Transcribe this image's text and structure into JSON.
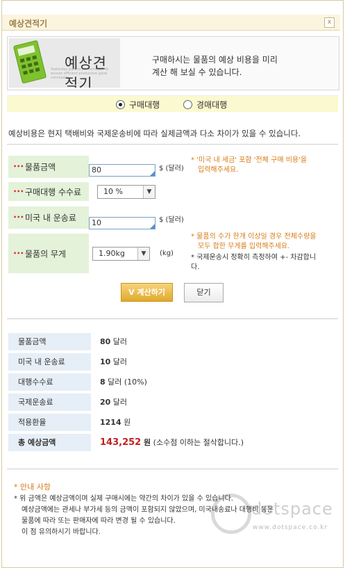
{
  "window": {
    "title": "예상견적기",
    "close_icon": "close-icon"
  },
  "hero": {
    "title": "예상견적기",
    "desc_line1": "구매하시는 물품의 예상 비용을 미리",
    "desc_line2": "계산 해 보실 수 있습니다.",
    "blur_text": "Yesterday plan to perform SEO to ensure efficient productive good conclusion"
  },
  "mode": {
    "option1": "구매대행",
    "option2": "경매대행",
    "selected": "구매대행"
  },
  "notice": "예상비용은 현지 택배비와 국제운송비에 따라 실제금액과 다소 차이가 있을 수 있습니다.",
  "form": {
    "price_label": "물품금액",
    "price_value": "80",
    "price_unit": "$ (달러)",
    "price_note_line1": "* '미국 내 세금' 포함 '전체 구매 비용'을",
    "price_note_line2": "입력해주세요.",
    "fee_label": "구매대행 수수료",
    "fee_value": "10 %",
    "shipping_label": "미국 내 운송료",
    "shipping_value": "10",
    "shipping_unit": "$ (달러)",
    "weight_label": "물품의 무게",
    "weight_value": "1.90kg",
    "weight_unit": "(kg)",
    "weight_note_line1": "* 물품의 수가 한개 이상일 경우 전체수량을",
    "weight_note_line2": "모두 합한 무게를 입력해주세요.",
    "weight_note2_line1": "* 국제운송시 정확히 측정하여 +- 차감합니",
    "weight_note2_line2": "다."
  },
  "buttons": {
    "calc": "V 계산하기",
    "close": "닫기"
  },
  "results": [
    {
      "label": "물품금액",
      "value": "80",
      "unit": " 달러"
    },
    {
      "label": "미국 내 운송료",
      "value": "10",
      "unit": " 달러"
    },
    {
      "label": "대행수수료",
      "value": "8",
      "unit": " 달러 (10%)"
    },
    {
      "label": "국제운송료",
      "value": "20",
      "unit": " 달러"
    },
    {
      "label": "적용환율",
      "value": "1214",
      "unit": " 원"
    },
    {
      "label": "총 예상금액",
      "value": "143,252",
      "unit": " 원",
      "suffix": " (소수점 이하는 절삭합니다.)"
    }
  ],
  "guide": {
    "heading": "* 안내 사항",
    "line1": "* 위 금액은 예상금액이며 실제 구매시에는 약간의 차이가 있을 수 있습니다.",
    "line2": "예상금액에는 관세나 부가세 등의 금액이 포함되지 않았으며, 미국내송료나 대행비 등은",
    "line3": "물품에 따라 또는 판매자에 따라 변경 될 수 있습니다.",
    "line4": "이 점 유의하시기 바랍니다."
  },
  "watermark": {
    "name": "dotspace",
    "url": "www.dotspace.co.kr"
  },
  "colors": {
    "accent": "#d87b14",
    "label_bg": "#e3f2d8",
    "result_bg": "#e6eef7",
    "total": "#c0201f"
  }
}
